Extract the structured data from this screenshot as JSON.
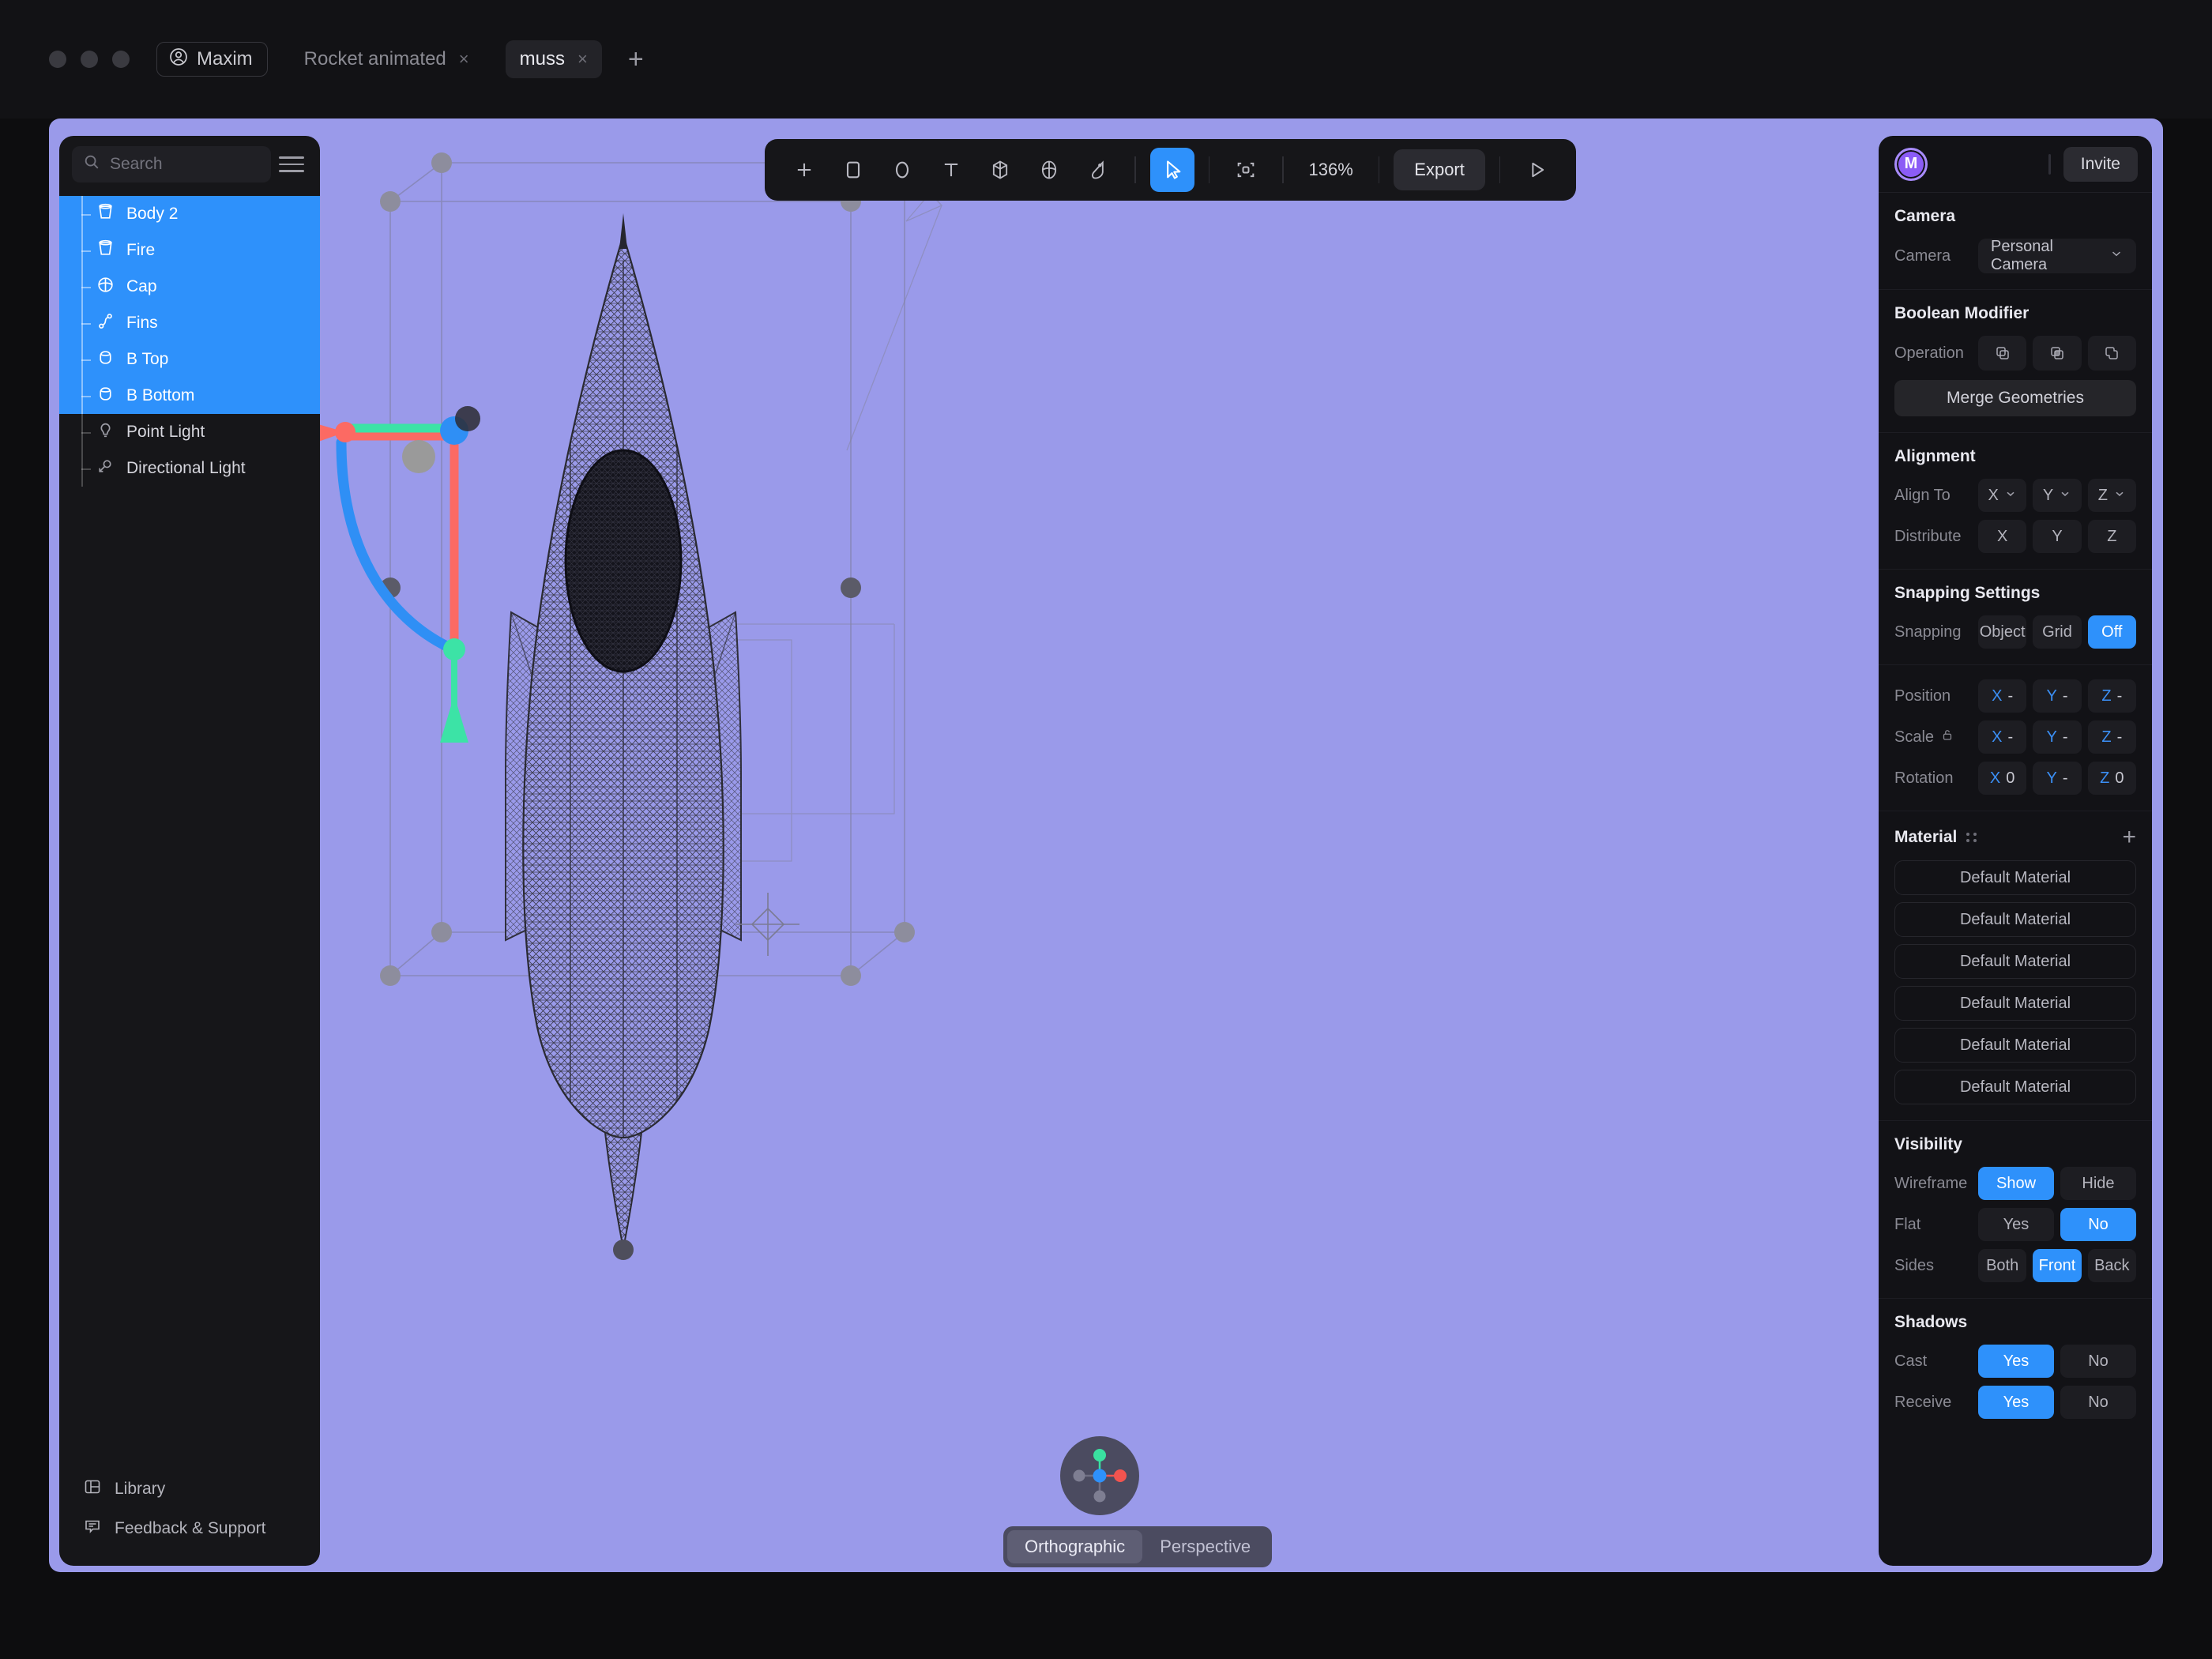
{
  "titlebar": {
    "user_chip": "Maxim",
    "tabs": [
      {
        "label": "Rocket animated",
        "close": "×",
        "active": false
      },
      {
        "label": "muss",
        "close": "×",
        "active": true
      }
    ],
    "add_tab": "+"
  },
  "sidebar": {
    "search_placeholder": "Search",
    "layers": [
      {
        "label": "Body 2",
        "icon": "cylinder-icon",
        "selected": true
      },
      {
        "label": "Fire",
        "icon": "cylinder-icon",
        "selected": true
      },
      {
        "label": "Cap",
        "icon": "sphere-icon",
        "selected": true
      },
      {
        "label": "Fins",
        "icon": "path-icon",
        "selected": true
      },
      {
        "label": "B Top",
        "icon": "cylinder-small-icon",
        "selected": true
      },
      {
        "label": "B Bottom",
        "icon": "cylinder-small-icon",
        "selected": true
      },
      {
        "label": "Point Light",
        "icon": "bulb-icon",
        "selected": false
      },
      {
        "label": "Directional Light",
        "icon": "directional-light-icon",
        "selected": false
      }
    ],
    "footer": [
      {
        "label": "Library",
        "icon": "library-icon"
      },
      {
        "label": "Feedback & Support",
        "icon": "feedback-icon"
      }
    ]
  },
  "toolbar": {
    "tools": [
      {
        "name": "add-icon",
        "active": false
      },
      {
        "name": "rectangle-icon",
        "active": false
      },
      {
        "name": "ellipse-icon",
        "active": false
      },
      {
        "name": "text-icon",
        "active": false
      },
      {
        "name": "cube-icon",
        "active": false
      },
      {
        "name": "sphere-icon",
        "active": false
      },
      {
        "name": "material-tag-icon",
        "active": false
      },
      {
        "name": "cursor-icon",
        "active": true
      },
      {
        "name": "frame-icon",
        "active": false
      }
    ],
    "zoom": "136%",
    "export_label": "Export",
    "play_icon": "play-icon"
  },
  "right_panel": {
    "avatar_initial": "M",
    "invite_label": "Invite",
    "camera": {
      "title": "Camera",
      "row_label": "Camera",
      "value": "Personal Camera"
    },
    "boolean": {
      "title": "Boolean Modifier",
      "row_label": "Operation",
      "operations": [
        "subtract-icon",
        "intersect-icon",
        "union-icon"
      ],
      "merge_label": "Merge Geometries"
    },
    "alignment": {
      "title": "Alignment",
      "align_to_label": "Align To",
      "align_to": [
        "X",
        "Y",
        "Z"
      ],
      "distribute_label": "Distribute",
      "distribute": [
        "X",
        "Y",
        "Z"
      ]
    },
    "snapping": {
      "title": "Snapping Settings",
      "row_label": "Snapping",
      "options": [
        {
          "label": "Object",
          "selected": false
        },
        {
          "label": "Grid",
          "selected": false
        },
        {
          "label": "Off",
          "selected": true
        }
      ]
    },
    "transform": {
      "position": {
        "label": "Position",
        "values": [
          {
            "axis": "X",
            "value": "-"
          },
          {
            "axis": "Y",
            "value": "-"
          },
          {
            "axis": "Z",
            "value": "-"
          }
        ]
      },
      "scale": {
        "label": "Scale",
        "lock_icon": "unlock-icon",
        "values": [
          {
            "axis": "X",
            "value": "-"
          },
          {
            "axis": "Y",
            "value": "-"
          },
          {
            "axis": "Z",
            "value": "-"
          }
        ]
      },
      "rotation": {
        "label": "Rotation",
        "values": [
          {
            "axis": "X",
            "value": "0"
          },
          {
            "axis": "Y",
            "value": "-"
          },
          {
            "axis": "Z",
            "value": "0"
          }
        ]
      }
    },
    "material": {
      "title": "Material",
      "add_icon": "+",
      "items": [
        "Default Material",
        "Default Material",
        "Default Material",
        "Default Material",
        "Default Material",
        "Default Material"
      ]
    },
    "visibility": {
      "title": "Visibility",
      "rows": [
        {
          "label": "Wireframe",
          "options": [
            {
              "label": "Show",
              "selected": true
            },
            {
              "label": "Hide",
              "selected": false
            }
          ]
        },
        {
          "label": "Flat",
          "options": [
            {
              "label": "Yes",
              "selected": false
            },
            {
              "label": "No",
              "selected": true
            }
          ]
        },
        {
          "label": "Sides",
          "options": [
            {
              "label": "Both",
              "selected": false
            },
            {
              "label": "Front",
              "selected": true
            },
            {
              "label": "Back",
              "selected": false
            }
          ]
        }
      ]
    },
    "shadows": {
      "title": "Shadows",
      "rows": [
        {
          "label": "Cast",
          "options": [
            {
              "label": "Yes",
              "selected": true
            },
            {
              "label": "No",
              "selected": false
            }
          ]
        },
        {
          "label": "Receive",
          "options": [
            {
              "label": "Yes",
              "selected": true
            },
            {
              "label": "No",
              "selected": false
            }
          ]
        }
      ]
    }
  },
  "viewport": {
    "projection": [
      {
        "label": "Orthographic",
        "selected": true
      },
      {
        "label": "Perspective",
        "selected": false
      }
    ],
    "axis_gizmo": {
      "x_color": "#f2544f",
      "y_color": "#3ae0a0",
      "center_color": "#2e91fb",
      "neg_color": "#7e7e92"
    },
    "gizmo": {
      "x_color": "#fc6a63",
      "y_color": "#3ce3a6",
      "z_color": "#2f8ff5",
      "center_color": "#9a9a9a"
    },
    "background_color": "#9a9aea",
    "accent_color": "#2e91fb"
  }
}
